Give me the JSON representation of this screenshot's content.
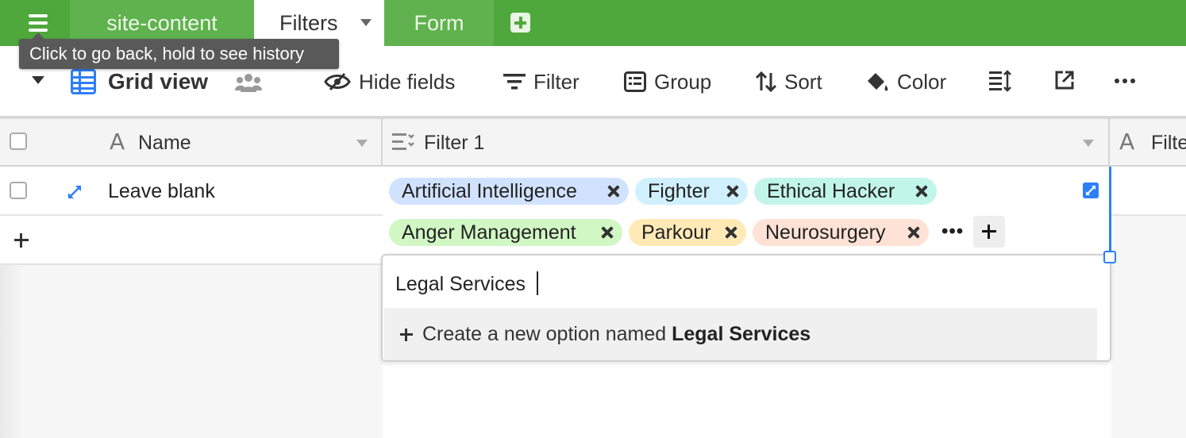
{
  "tabs": {
    "site_content": "site-content",
    "filters": "Filters",
    "form": "Form"
  },
  "tooltip": "Click to go back, hold to see history",
  "toolbar": {
    "view_name": "Grid view",
    "hide_fields": "Hide fields",
    "filter": "Filter",
    "group": "Group",
    "sort": "Sort",
    "color": "Color"
  },
  "grid": {
    "columns": [
      "Name",
      "Filter 1",
      "Filte"
    ],
    "rows": [
      {
        "name": "Leave blank"
      }
    ],
    "chips": [
      {
        "label": "Artificial Intelligence",
        "color": "#d1e2ff"
      },
      {
        "label": "Fighter",
        "color": "#d0f0fd"
      },
      {
        "label": "Ethical Hacker",
        "color": "#c2f5e9"
      },
      {
        "label": "Anger Management",
        "color": "#d1f7c4"
      },
      {
        "label": "Parkour",
        "color": "#ffeab6"
      },
      {
        "label": "Neurosurgery",
        "color": "#fee2d5"
      }
    ],
    "more": "•••"
  },
  "dropdown": {
    "input_value": "Legal Services",
    "create_prefix": "Create a new option named ",
    "create_name": "Legal Services"
  },
  "colors": {
    "brand_green": "#4fa83b",
    "accent_blue": "#2d7ff9"
  }
}
